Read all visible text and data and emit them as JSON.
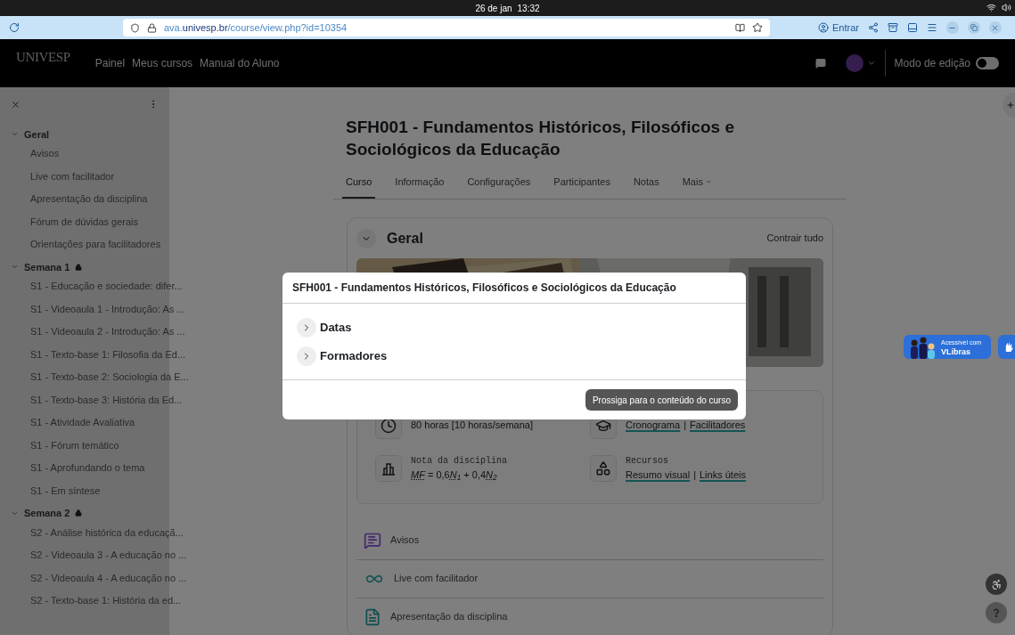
{
  "system_bar": {
    "date": "26 de jan",
    "time": "13:32"
  },
  "browser": {
    "url_host_start": "ava.",
    "url_domain": "univesp.br",
    "url_path": "/course/view.php?id=10354",
    "sign_in": "Entrar"
  },
  "navbar": {
    "logo": "UNIVESP",
    "links": [
      "Painel",
      "Meus cursos",
      "Manual do Aluno"
    ],
    "edit_mode": {
      "label": "Modo de edição",
      "on": false
    }
  },
  "sidebar": {
    "sections": [
      {
        "title": "Geral",
        "expanded": true,
        "children": [
          "Avisos",
          "Live com facilitador",
          "Apresentação da disciplina",
          "Fórum de dúvidas gerais",
          "Orientações para facilitadores"
        ]
      },
      {
        "title": "Semana 1",
        "locked": true,
        "expanded": true,
        "children": [
          "S1 - Educação e sociedade: difer...",
          "S1 - Videoaula 1 - Introdução: As ...",
          "S1 - Videoaula 2 - Introdução: As ...",
          "S1 - Texto-base 1: Filosofia da Ed...",
          "S1 - Texto-base 2: Sociologia da E...",
          "S1 - Texto-base 3: História da Ed...",
          "S1 - Atividade Avaliativa",
          "S1 - Fórum temático",
          "S1 - Aprofundando o tema",
          "S1 - Em síntese"
        ]
      },
      {
        "title": "Semana 2",
        "locked": true,
        "expanded": true,
        "children": [
          "S2 - Análise histórica da educaçã...",
          "S2 - Videoaula 3 - A educação no ...",
          "S2 - Videoaula 4 - A educação no ...",
          "S2 - Texto-base 1: História da ed..."
        ]
      }
    ]
  },
  "course": {
    "title": "SFH001 - Fundamentos Históricos, Filosóficos e Sociológicos da Educação",
    "tabs": [
      {
        "label": "Curso",
        "selected": true
      },
      {
        "label": "Informação",
        "selected": false
      },
      {
        "label": "Configurações",
        "selected": false
      },
      {
        "label": "Participantes",
        "selected": false
      },
      {
        "label": "Notas",
        "selected": false
      },
      {
        "label": "Mais",
        "selected": false
      }
    ],
    "section": {
      "title": "Geral",
      "expanded": true,
      "collapse_all": "Contrair tudo"
    },
    "info": [
      {
        "kind": "clock",
        "value": "80 horas [10 horas/semana]"
      },
      {
        "kind": "cap",
        "links": [
          "Cronograma",
          "Facilitadores"
        ],
        "separator": "|"
      },
      {
        "kind": "chart",
        "label": "Nota da disciplina",
        "formula": [
          {
            "text": "MF",
            "kind": "variable"
          },
          {
            "text": " = 0,6",
            "kind": "term"
          },
          {
            "text": "N",
            "kind": "variable"
          },
          {
            "text": "1",
            "kind": "index"
          },
          {
            "text": " + 0,4",
            "kind": "term"
          },
          {
            "text": "N",
            "kind": "variable"
          },
          {
            "text": "2",
            "kind": "index"
          }
        ]
      },
      {
        "kind": "shapes",
        "label": "Recursos",
        "links": [
          "Resumo visual",
          "Links úteis"
        ],
        "separator": "|"
      }
    ],
    "activities": [
      {
        "kind": "forum",
        "label": "Avisos"
      },
      {
        "kind": "live",
        "label": "Live com facilitador"
      },
      {
        "kind": "page",
        "label": "Apresentação da disciplina"
      }
    ]
  },
  "vlibras": {
    "line1": "Acessível com",
    "line2": "VLibras"
  },
  "modal": {
    "title": "SFH001 - Fundamentos Históricos, Filosóficos e Sociológicos da Educação",
    "sections": [
      {
        "label": "Datas",
        "expanded": false
      },
      {
        "label": "Formadores",
        "expanded": false
      }
    ],
    "button": "Prossiga para o conteúdo do curso"
  }
}
